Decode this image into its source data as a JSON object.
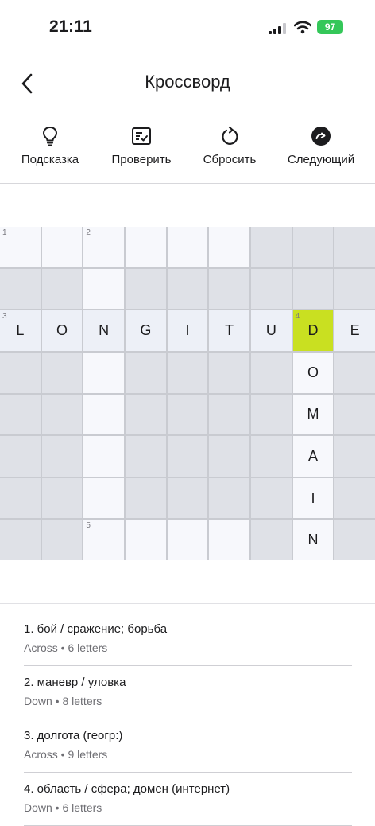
{
  "status_bar": {
    "time": "21:11",
    "battery": "97"
  },
  "header": {
    "title": "Кроссворд"
  },
  "toolbar": [
    {
      "label": "Подсказка",
      "icon": "lightbulb-icon"
    },
    {
      "label": "Проверить",
      "icon": "checklist-icon"
    },
    {
      "label": "Сбросить",
      "icon": "reset-icon"
    },
    {
      "label": "Следующий",
      "icon": "next-icon"
    }
  ],
  "colors": {
    "active_cell": "#c9e021",
    "block_cell": "#dfe1e7",
    "open_cell": "#f7f8fc",
    "battery": "#34c759"
  },
  "grid": {
    "rows": 8,
    "cols": 9,
    "cells": [
      [
        {
          "n": "1"
        },
        {},
        {
          "n": "2"
        },
        {},
        {},
        {},
        {
          "b": 1
        },
        {
          "b": 1
        },
        {
          "b": 1
        }
      ],
      [
        {
          "b": 1
        },
        {
          "b": 1
        },
        {},
        {
          "b": 1
        },
        {
          "b": 1
        },
        {
          "b": 1
        },
        {
          "b": 1
        },
        {
          "b": 1
        },
        {
          "b": 1
        }
      ],
      [
        {
          "n": "3",
          "l": "L",
          "h": 1
        },
        {
          "l": "O",
          "h": 1
        },
        {
          "l": "N",
          "h": 1
        },
        {
          "l": "G",
          "h": 1
        },
        {
          "l": "I",
          "h": 1
        },
        {
          "l": "T",
          "h": 1
        },
        {
          "l": "U",
          "h": 1
        },
        {
          "n": "4",
          "l": "D",
          "a": 1
        },
        {
          "l": "E",
          "h": 1
        }
      ],
      [
        {
          "b": 1
        },
        {
          "b": 1
        },
        {},
        {
          "b": 1
        },
        {
          "b": 1
        },
        {
          "b": 1
        },
        {
          "b": 1
        },
        {
          "l": "O"
        },
        {
          "b": 1
        }
      ],
      [
        {
          "b": 1
        },
        {
          "b": 1
        },
        {},
        {
          "b": 1
        },
        {
          "b": 1
        },
        {
          "b": 1
        },
        {
          "b": 1
        },
        {
          "l": "M"
        },
        {
          "b": 1
        }
      ],
      [
        {
          "b": 1
        },
        {
          "b": 1
        },
        {},
        {
          "b": 1
        },
        {
          "b": 1
        },
        {
          "b": 1
        },
        {
          "b": 1
        },
        {
          "l": "A"
        },
        {
          "b": 1
        }
      ],
      [
        {
          "b": 1
        },
        {
          "b": 1
        },
        {},
        {
          "b": 1
        },
        {
          "b": 1
        },
        {
          "b": 1
        },
        {
          "b": 1
        },
        {
          "l": "I"
        },
        {
          "b": 1
        }
      ],
      [
        {
          "b": 1
        },
        {
          "b": 1
        },
        {
          "n": "5"
        },
        {},
        {},
        {},
        {
          "b": 1
        },
        {
          "l": "N"
        },
        {
          "b": 1
        }
      ]
    ]
  },
  "clues": [
    {
      "text": "1. бой / сражение; борьба",
      "meta": "Across • 6 letters"
    },
    {
      "text": "2. маневр / уловка",
      "meta": "Down • 8 letters"
    },
    {
      "text": "3. долгота (геогр:)",
      "meta": "Across • 9 letters"
    },
    {
      "text": "4. область / сфера; домен (интернет)",
      "meta": "Down • 6 letters"
    }
  ]
}
